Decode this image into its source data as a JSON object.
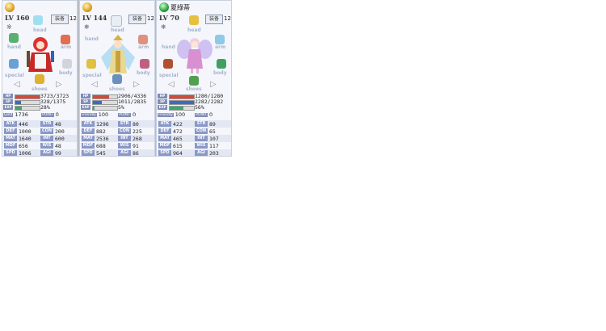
{
  "slot_labels": {
    "head": "head",
    "hand": "hand",
    "arm": "arm",
    "body": "body",
    "special": "special",
    "shoes": "shoes"
  },
  "arrows": {
    "left": "◁",
    "right": "▷"
  },
  "bar_labels": {
    "hp": "HP",
    "sp": "SP",
    "exp": "EXP"
  },
  "stat_labels": [
    "ATK",
    "DEF",
    "MAT",
    "MDF",
    "SPD"
  ],
  "stat_labels_right": [
    "STR",
    "CON",
    "INT",
    "WIS",
    "AGI"
  ],
  "colors": {
    "hp": "#d24a3a",
    "sp": "#3a6ac8",
    "exp": "#3aa86a",
    "panel": "#f4f6fb"
  },
  "characters": [
    {
      "element_icon": "sun-element-icon",
      "name": "",
      "level": "LV 160",
      "equip_label": "装备",
      "equip_count": "12",
      "status_symbol": "※",
      "hp": "3723/3723",
      "hp_pct": 100,
      "sp": "328/1375",
      "sp_pct": 24,
      "exp": "28%",
      "exp_pct": 28,
      "misc_label": "Gold",
      "misc_value": "1736",
      "point_label": "POINT",
      "point_value": "0",
      "stats_left": [
        "446",
        "1000",
        "1640",
        "656",
        "1006"
      ],
      "stats_right": [
        "48",
        "200",
        "600",
        "48",
        "99"
      ]
    },
    {
      "element_icon": "sun-element-icon",
      "name": "",
      "level": "LV 144",
      "equip_label": "装备",
      "equip_count": "12",
      "status_symbol": "❄",
      "hp": "2906/4336",
      "hp_pct": 67,
      "sp": "1011/2835",
      "sp_pct": 36,
      "exp": "5%",
      "exp_pct": 5,
      "misc_label": "Friendly",
      "misc_value": "100",
      "point_label": "POINT",
      "point_value": "0",
      "stats_left": [
        "1296",
        "882",
        "2536",
        "688",
        "545"
      ],
      "stats_right": [
        "80",
        "225",
        "268",
        "91",
        "86"
      ]
    },
    {
      "element_icon": "leaf-element-icon",
      "name": "夏綠蒂",
      "level": "LV 70",
      "equip_label": "装备",
      "equip_count": "12",
      "status_symbol": "❄",
      "hp": "1280/1280",
      "hp_pct": 100,
      "sp": "2282/2282",
      "sp_pct": 100,
      "exp": "56%",
      "exp_pct": 56,
      "misc_label": "Friendly",
      "misc_value": "100",
      "point_label": "POINT",
      "point_value": "0",
      "stats_left": [
        "422",
        "472",
        "465",
        "615",
        "964"
      ],
      "stats_right": [
        "89",
        "65",
        "107",
        "117",
        "203"
      ]
    }
  ]
}
